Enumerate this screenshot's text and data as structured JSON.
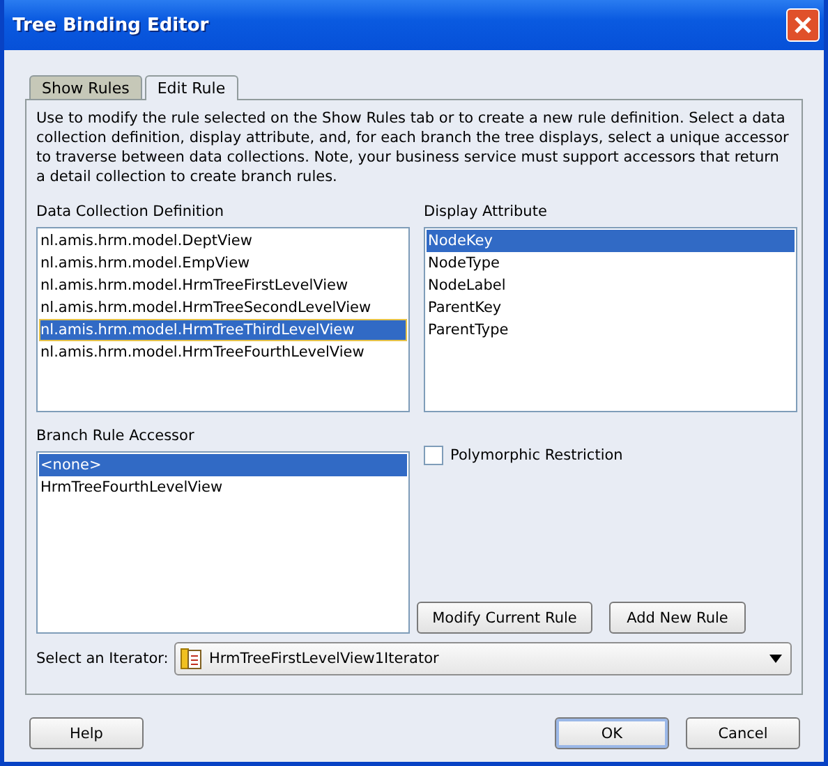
{
  "window": {
    "title": "Tree Binding Editor"
  },
  "tabs": [
    {
      "label": "Show Rules",
      "selected": false
    },
    {
      "label": "Edit Rule",
      "selected": true
    }
  ],
  "description": "Use to modify the rule selected on the Show Rules tab or to create a new rule definition. Select a data collection definition, display attribute, and, for each branch the tree displays, select a unique accessor to traverse between data collections. Note, your business service must support accessors that return a detail collection to create branch rules.",
  "data_collection": {
    "label": "Data Collection Definition",
    "items": [
      {
        "text": "nl.amis.hrm.model.DeptView",
        "selected": false
      },
      {
        "text": "nl.amis.hrm.model.EmpView",
        "selected": false
      },
      {
        "text": "nl.amis.hrm.model.HrmTreeFirstLevelView",
        "selected": false
      },
      {
        "text": "nl.amis.hrm.model.HrmTreeSecondLevelView",
        "selected": false
      },
      {
        "text": "nl.amis.hrm.model.HrmTreeThirdLevelView",
        "selected": true
      },
      {
        "text": "nl.amis.hrm.model.HrmTreeFourthLevelView",
        "selected": false
      }
    ]
  },
  "display_attribute": {
    "label": "Display Attribute",
    "items": [
      {
        "text": "NodeKey",
        "selected": true
      },
      {
        "text": "NodeType",
        "selected": false
      },
      {
        "text": "NodeLabel",
        "selected": false
      },
      {
        "text": "ParentKey",
        "selected": false
      },
      {
        "text": "ParentType",
        "selected": false
      }
    ]
  },
  "branch_rule_accessor": {
    "label": "Branch Rule Accessor",
    "items": [
      {
        "text": "<none>",
        "selected": true
      },
      {
        "text": "HrmTreeFourthLevelView",
        "selected": false
      }
    ]
  },
  "polymorphic_restriction": {
    "label": "Polymorphic Restriction",
    "checked": false
  },
  "rule_buttons": [
    "Modify Current Rule",
    "Add New Rule"
  ],
  "iterator": {
    "label": "Select an Iterator:",
    "value": "HrmTreeFirstLevelView1Iterator"
  },
  "buttons": {
    "help": "Help",
    "ok": "OK",
    "cancel": "Cancel"
  }
}
